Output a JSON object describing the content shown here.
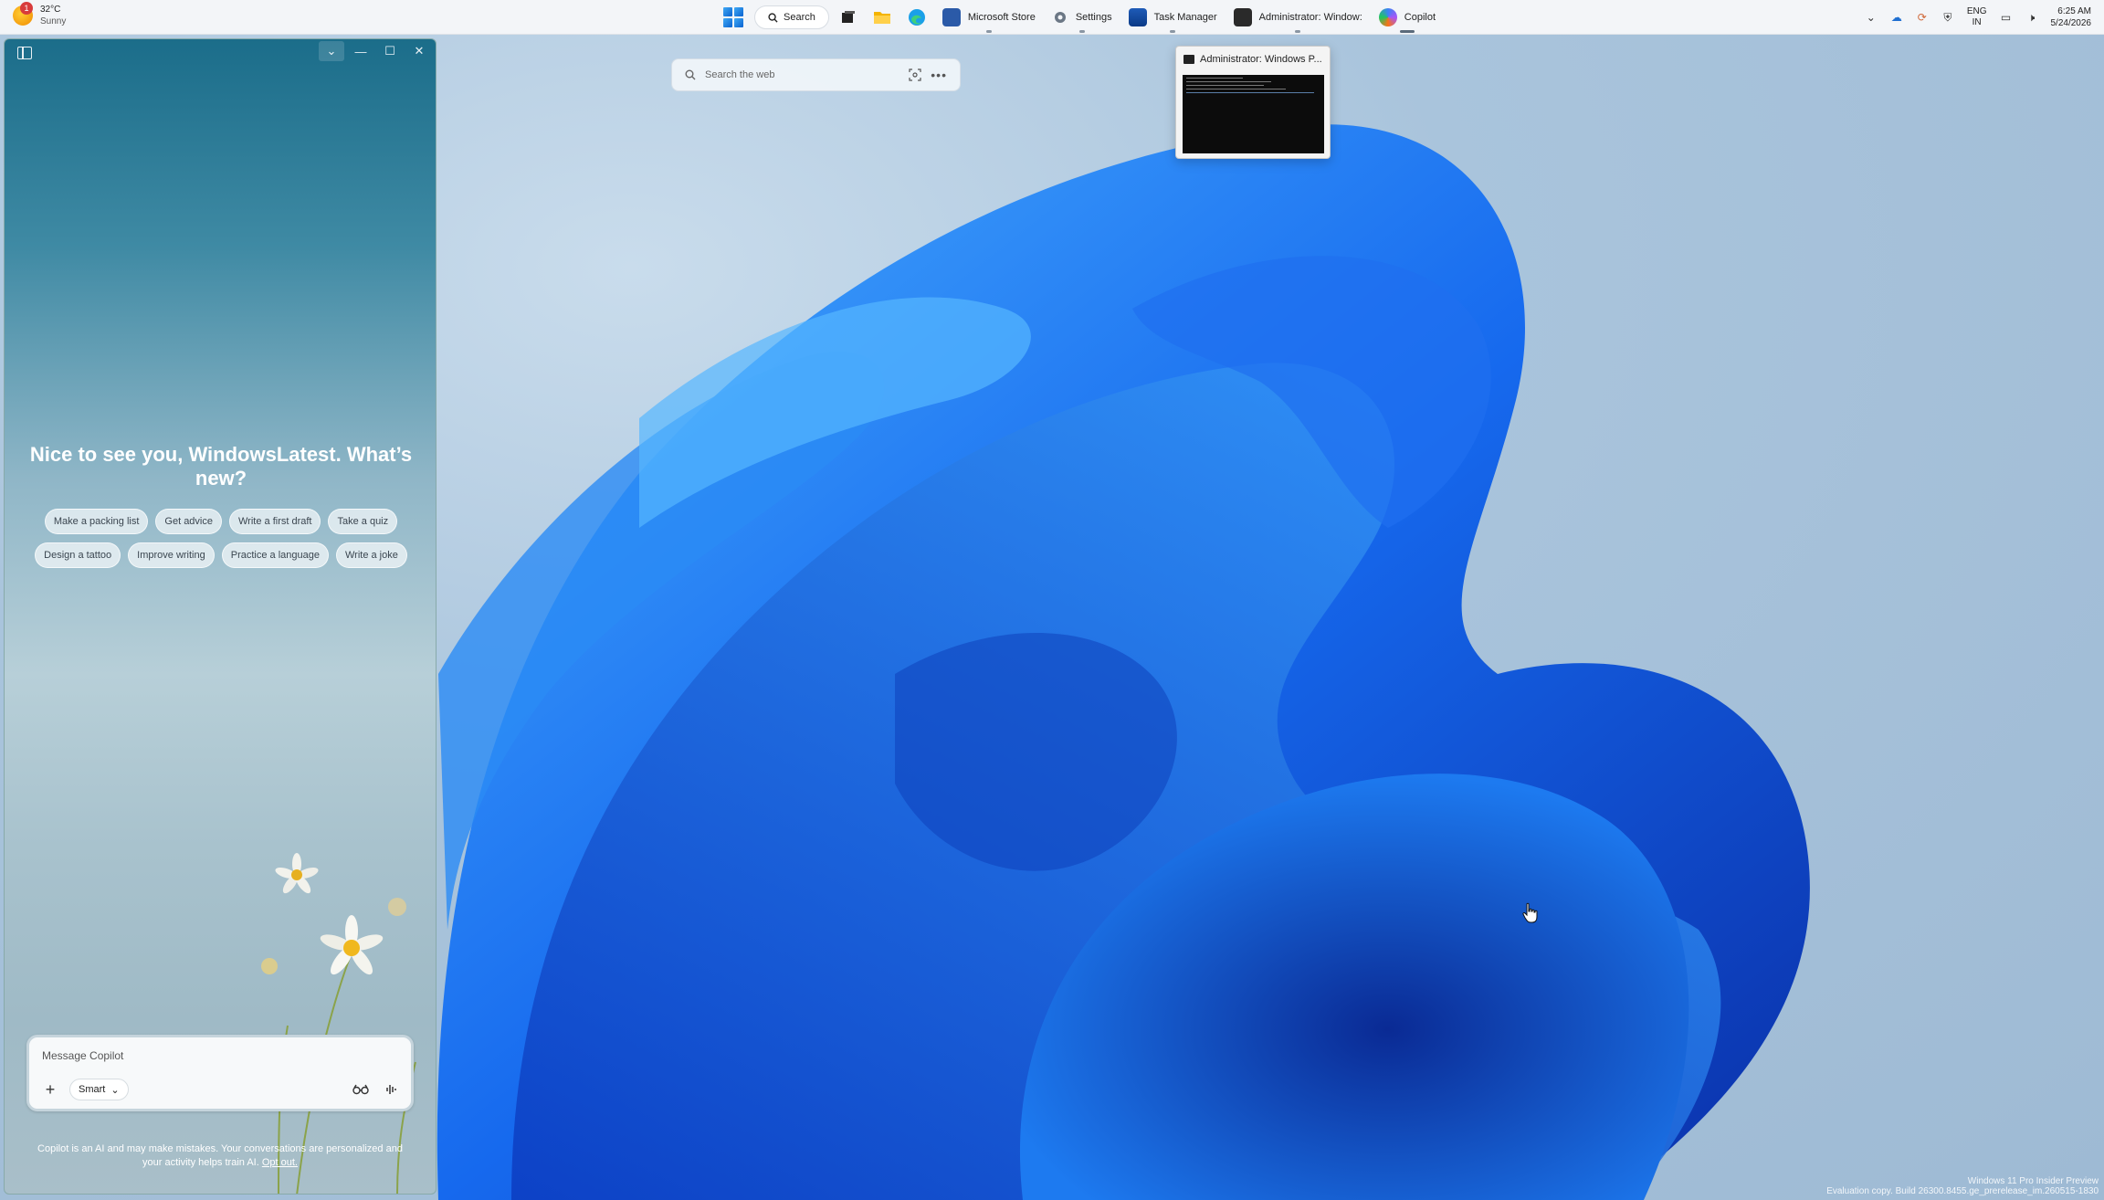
{
  "weather": {
    "badge": "1",
    "temp": "32°C",
    "condition": "Sunny"
  },
  "taskbar": {
    "search_label": "Search",
    "apps": [
      {
        "label": "Microsoft Store"
      },
      {
        "label": "Settings"
      },
      {
        "label": "Task Manager"
      },
      {
        "label": "Administrator: Window:"
      },
      {
        "label": "Copilot"
      }
    ]
  },
  "tray": {
    "lang_top": "ENG",
    "lang_bottom": "IN",
    "time": "6:25 AM",
    "date": "5/24/2026"
  },
  "copilot": {
    "greeting": "Nice to see you, WindowsLatest. What’s new?",
    "chips": [
      "Make a packing list",
      "Get advice",
      "Write a first draft",
      "Take a quiz",
      "Design a tattoo",
      "Improve writing",
      "Practice a language",
      "Write a joke"
    ],
    "composer_placeholder": "Message Copilot",
    "mode_label": "Smart",
    "disclaimer": "Copilot is an AI and may make mistakes. Your conversations are personalized and your activity helps train AI.",
    "opt_out": "Opt out."
  },
  "websearch": {
    "placeholder": "Search the web"
  },
  "preview": {
    "title": "Administrator: Windows P..."
  },
  "watermark": {
    "line1": "Windows 11 Pro Insider Preview",
    "line2": "Evaluation copy. Build 26300.8455.ge_prerelease_im.260515-1830"
  },
  "colors": {
    "accent": "#0a62d0",
    "copilot_top": "#1b6d8a",
    "taskbar": "#f3f5f8"
  }
}
